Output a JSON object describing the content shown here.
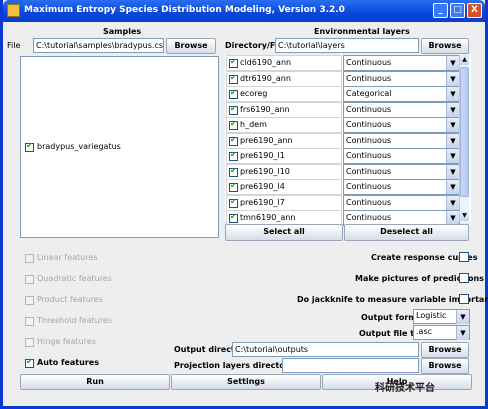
{
  "window": {
    "title": "Maximum Entropy Species Distribution Modeling, Version 3.2.0",
    "min_label": "_",
    "max_label": "□",
    "close_label": "X"
  },
  "samples": {
    "header": "Samples",
    "file_label": "File",
    "file_value": "C:\\tutorial\\samples\\bradypus.csv",
    "browse_label": "Browse",
    "species": [
      {
        "name": "bradypus_variegatus",
        "checked": true
      }
    ]
  },
  "env": {
    "header": "Environmental layers",
    "dir_label": "Directory/File",
    "dir_value": "C:\\tutorial\\layers",
    "browse_label": "Browse",
    "layers": [
      {
        "name": "cld6190_ann",
        "type": "Continuous"
      },
      {
        "name": "dtr6190_ann",
        "type": "Continuous"
      },
      {
        "name": "ecoreg",
        "type": "Categorical"
      },
      {
        "name": "frs6190_ann",
        "type": "Continuous"
      },
      {
        "name": "h_dem",
        "type": "Continuous"
      },
      {
        "name": "pre6190_ann",
        "type": "Continuous"
      },
      {
        "name": "pre6190_l1",
        "type": "Continuous"
      },
      {
        "name": "pre6190_l10",
        "type": "Continuous"
      },
      {
        "name": "pre6190_l4",
        "type": "Continuous"
      },
      {
        "name": "pre6190_l7",
        "type": "Continuous"
      },
      {
        "name": "tmn6190_ann",
        "type": "Continuous"
      }
    ],
    "select_all_label": "Select all",
    "deselect_all_label": "Deselect all"
  },
  "features": [
    {
      "label": "Linear features",
      "enabled": false,
      "checked": false
    },
    {
      "label": "Quadratic features",
      "enabled": false,
      "checked": false
    },
    {
      "label": "Product features",
      "enabled": false,
      "checked": false
    },
    {
      "label": "Threshold features",
      "enabled": false,
      "checked": false
    },
    {
      "label": "Hinge features",
      "enabled": false,
      "checked": false
    },
    {
      "label": "Auto features",
      "enabled": true,
      "checked": true
    }
  ],
  "options": {
    "response_curves": "Create response curves",
    "pictures": "Make pictures of predictions",
    "jackknife": "Do jackknife to measure variable importance",
    "output_format_label": "Output format",
    "output_format_value": "Logistic",
    "output_file_type_label": "Output file type",
    "output_file_type_value": ".asc",
    "output_dir_label": "Output directory",
    "output_dir_value": "C:\\tutorial\\outputs",
    "output_browse_label": "Browse",
    "projection_label": "Projection layers directory/file",
    "projection_value": "",
    "projection_browse_label": "Browse"
  },
  "bottom": {
    "run_label": "Run",
    "settings_label": "Settings",
    "help_label": "Help"
  },
  "watermark": "科研技术平台"
}
